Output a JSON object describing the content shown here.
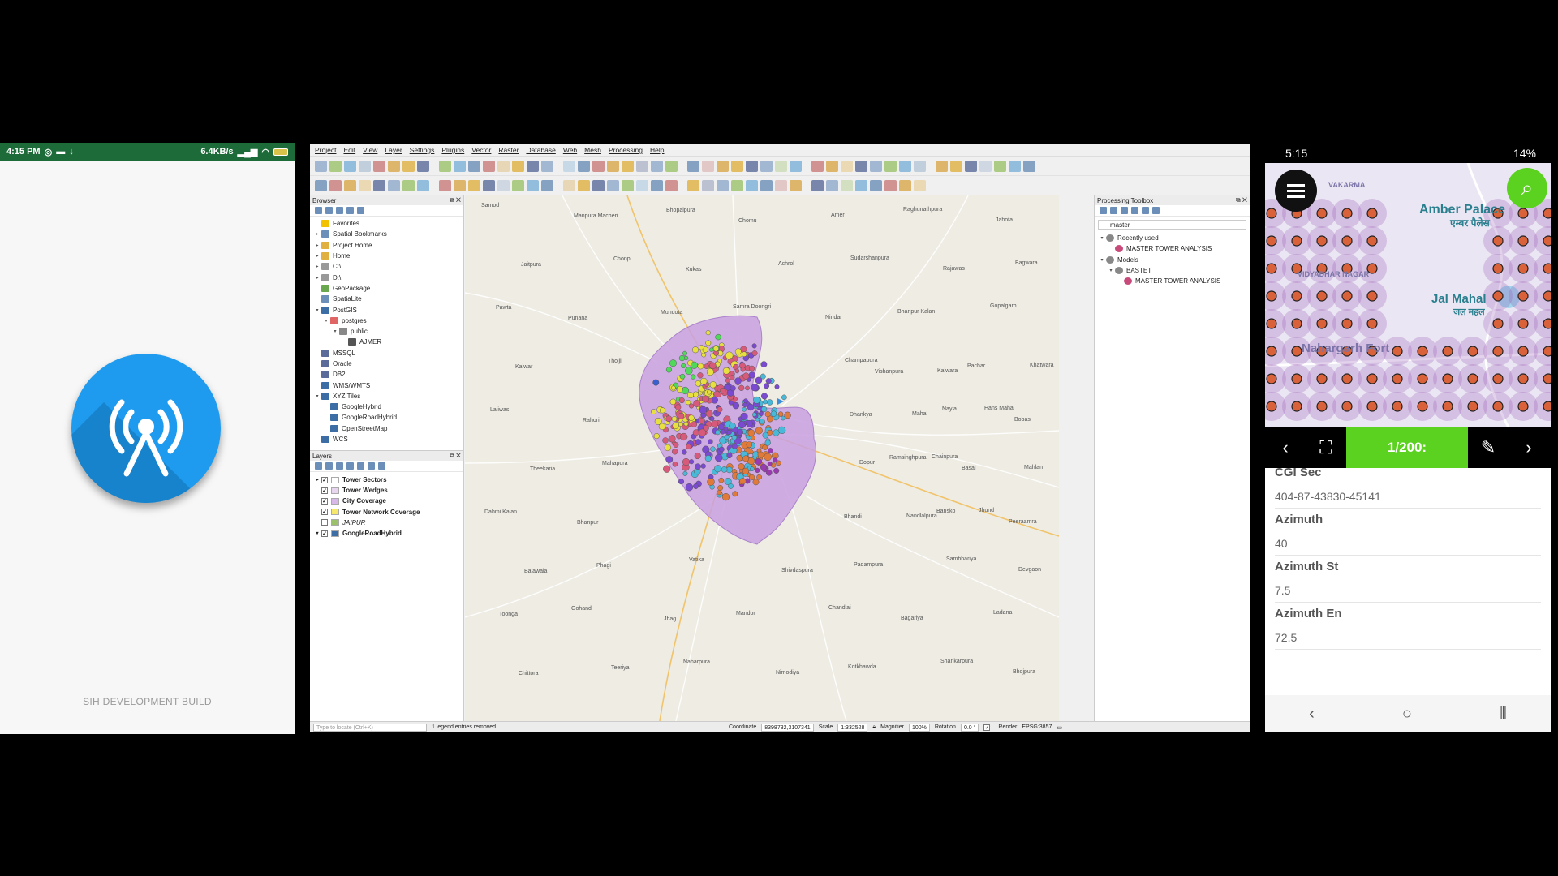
{
  "left_phone": {
    "status_time": "4:15 PM",
    "status_net": "6.4KB/s",
    "build_label": "SIH DEVELOPMENT BUILD",
    "logo_icon": "radio-tower-icon",
    "logo_color": "#1e9bef"
  },
  "qgis": {
    "menu": [
      "Project",
      "Edit",
      "View",
      "Layer",
      "Settings",
      "Plugins",
      "Vector",
      "Raster",
      "Database",
      "Web",
      "Mesh",
      "Processing",
      "Help"
    ],
    "browser": {
      "title": "Browser",
      "items": [
        {
          "label": "Favorites",
          "depth": 0,
          "arrow": "",
          "color": "#f2c200"
        },
        {
          "label": "Spatial Bookmarks",
          "depth": 0,
          "arrow": "▸",
          "color": "#6b8fb8"
        },
        {
          "label": "Project Home",
          "depth": 0,
          "arrow": "▸",
          "color": "#e0b040"
        },
        {
          "label": "Home",
          "depth": 0,
          "arrow": "▸",
          "color": "#e0b040"
        },
        {
          "label": "C:\\",
          "depth": 0,
          "arrow": "▸",
          "color": "#999"
        },
        {
          "label": "D:\\",
          "depth": 0,
          "arrow": "▸",
          "color": "#999"
        },
        {
          "label": "GeoPackage",
          "depth": 0,
          "arrow": "",
          "color": "#6aa84f"
        },
        {
          "label": "SpatiaLite",
          "depth": 0,
          "arrow": "",
          "color": "#6b8fb8"
        },
        {
          "label": "PostGIS",
          "depth": 0,
          "arrow": "▾",
          "color": "#3c6ea5"
        },
        {
          "label": "postgres",
          "depth": 1,
          "arrow": "▾",
          "color": "#e06666"
        },
        {
          "label": "public",
          "depth": 2,
          "arrow": "▾",
          "color": "#888"
        },
        {
          "label": "AJMER",
          "depth": 3,
          "arrow": "",
          "color": "#555"
        },
        {
          "label": "MSSQL",
          "depth": 0,
          "arrow": "",
          "color": "#5b6b9a"
        },
        {
          "label": "Oracle",
          "depth": 0,
          "arrow": "",
          "color": "#5b6b9a"
        },
        {
          "label": "DB2",
          "depth": 0,
          "arrow": "",
          "color": "#5b6b9a"
        },
        {
          "label": "WMS/WMTS",
          "depth": 0,
          "arrow": "",
          "color": "#3c6ea5"
        },
        {
          "label": "XYZ Tiles",
          "depth": 0,
          "arrow": "▾",
          "color": "#3c6ea5"
        },
        {
          "label": "GoogleHybrid",
          "depth": 1,
          "arrow": "",
          "color": "#3c6ea5"
        },
        {
          "label": "GoogleRoadHybrid",
          "depth": 1,
          "arrow": "",
          "color": "#3c6ea5"
        },
        {
          "label": "OpenStreetMap",
          "depth": 1,
          "arrow": "",
          "color": "#3c6ea5"
        },
        {
          "label": "WCS",
          "depth": 0,
          "arrow": "",
          "color": "#3c6ea5"
        }
      ]
    },
    "layers": {
      "title": "Layers",
      "items": [
        {
          "label": "Tower Sectors",
          "checked": true,
          "arrow": "▸",
          "swatch": "#ffffff",
          "italic": false
        },
        {
          "label": "Tower Wedges",
          "checked": true,
          "arrow": "",
          "swatch": "#e8d6f0",
          "italic": false
        },
        {
          "label": "City Coverage",
          "checked": true,
          "arrow": "",
          "swatch": "#d8b8e8",
          "italic": false
        },
        {
          "label": "Tower Network Coverage",
          "checked": true,
          "arrow": "",
          "swatch": "#f5e86b",
          "italic": false
        },
        {
          "label": "JAIPUR",
          "checked": false,
          "arrow": "",
          "swatch": "#9bc26a",
          "italic": true
        },
        {
          "label": "GoogleRoadHybrid",
          "checked": true,
          "arrow": "▾",
          "swatch": "#3c6ea5",
          "italic": false
        }
      ]
    },
    "processing": {
      "title": "Processing Toolbox",
      "search_value": "master",
      "items": [
        {
          "label": "Recently used",
          "depth": 0,
          "arrow": "▾"
        },
        {
          "label": "MASTER TOWER ANALYSIS",
          "depth": 1,
          "arrow": ""
        },
        {
          "label": "Models",
          "depth": 0,
          "arrow": "▾"
        },
        {
          "label": "BASTET",
          "depth": 1,
          "arrow": "▾"
        },
        {
          "label": "MASTER TOWER ANALYSIS",
          "depth": 2,
          "arrow": ""
        }
      ]
    },
    "map_labels": [
      "Samod",
      "Manpura Macheri",
      "Bhopalpura",
      "Chomu",
      "Amer",
      "Raghunathpura",
      "Jahota",
      "Jaitpura",
      "Chonp",
      "Kukas",
      "Achrol",
      "Sudarshanpura",
      "Rajawas",
      "Bagwara",
      "Pawta",
      "Punana",
      "Mundota",
      "Samra Doongri",
      "Nindar",
      "Bhanpur Kalan",
      "Gopalgarh",
      "Kalwar",
      "Thoiji",
      "Vishanpura",
      "Pachar",
      "Champapura",
      "Kalwara",
      "Khatwara",
      "Laliwas",
      "Rahori",
      "Dhankya",
      "Nayla",
      "Bobas",
      "Mahal",
      "Hans Mahal",
      "Theekaria",
      "Mahapura",
      "Ramsinghpura",
      "Basai",
      "Dopur",
      "Chainpura",
      "Mahlan",
      "Dahmi Kalan",
      "Bhanpur",
      "Bhandi",
      "Bansko",
      "Peeraamra",
      "Nandlalpura",
      "Jhund",
      "Balawala",
      "Phagi",
      "Vatika",
      "Shivdaspura",
      "Padampura",
      "Sambhariya",
      "Devgaon",
      "Toonga",
      "Gohandi",
      "Jhag",
      "Mandor",
      "Chandlai",
      "Bagariya",
      "Ladana",
      "Chittora",
      "Teeriya",
      "Naharpura",
      "Nimodiya",
      "Kotkhawda",
      "Shankarpura",
      "Bhojpura"
    ],
    "status": {
      "locate_placeholder": "Type to locate (Ctrl+K)",
      "message": "1 legend entries removed.",
      "coordinate_label": "Coordinate",
      "coordinate": "8398732,3107341",
      "scale_label": "Scale",
      "scale": "1:332528",
      "magnifier_label": "Magnifier",
      "magnifier": "100%",
      "rotation_label": "Rotation",
      "rotation": "0.0 °",
      "render_label": "Render",
      "crs": "EPSG:3857"
    }
  },
  "right_phone": {
    "status_time": "5:15",
    "battery": "14%",
    "map_labels": [
      "Amber Palace",
      "एम्बर पैलेस",
      "Jal Mahal",
      "जल महल",
      "Nahargarh Fort",
      "VIDYADHAR NAGAR",
      "VAKARMA"
    ],
    "counter": "1/200:",
    "fields": [
      {
        "label": "CGI Sec",
        "value": "404-87-43830-45141"
      },
      {
        "label": "Azimuth",
        "value": "40"
      },
      {
        "label": "Azimuth St",
        "value": "7.5"
      },
      {
        "label": "Azimuth En",
        "value": "72.5"
      }
    ],
    "accent": "#5ad21f"
  }
}
